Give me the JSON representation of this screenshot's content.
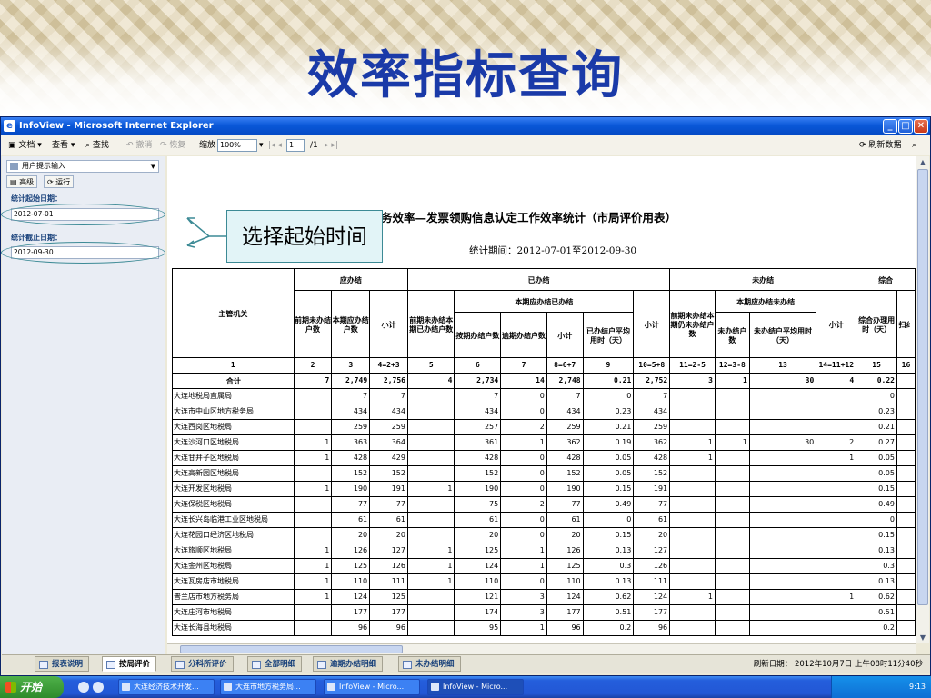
{
  "slide": {
    "title": "效率指标查询",
    "annotation": "选择起始时间"
  },
  "window": {
    "title": "InfoView - Microsoft Internet Explorer"
  },
  "toolbar": {
    "document": "文档",
    "view": "查看",
    "find": "查找",
    "undo": "撤消",
    "redo": "恢复",
    "zoom_label": "缩放",
    "zoom_value": "100%",
    "page_value": "1",
    "page_total": "/1",
    "refresh": "刷新数据"
  },
  "left_panel": {
    "prompt_dropdown": "用户提示输入",
    "advanced": "高级",
    "run": "运行",
    "start_label": "统计起始日期：",
    "start_value": "2012-07-01",
    "end_label": "统计截止日期：",
    "end_value": "2012-09-30"
  },
  "report": {
    "title": "务效率—发票领购信息认定工作效率统计（市局评价用表）",
    "period": "统计期间：2012-07-01至2012-09-30",
    "headers": {
      "org": "主管机关",
      "due": "应办结",
      "done": "已办结",
      "undone": "未办结",
      "overall": "综合",
      "done_current": "本期应办结已办结",
      "undone_current": "本期应办结未办结",
      "prior_unfinished": "前期未办结户数",
      "current_due": "本期应办结户数",
      "subtotal": "小计",
      "prior_finished": "前期未办结本期已办结户数",
      "ontime": "按期办结户数",
      "overdue": "逾期办结户数",
      "avg_time": "已办结户平均用时（天）",
      "prior_still": "前期未办结本期仍未办结户数",
      "not_done": "未办结户数",
      "undone_avg": "未办结户平均用时（天）",
      "overall_time": "综合办理用时（天）",
      "c16": "扫纟"
    },
    "index_row": [
      "1",
      "2",
      "3",
      "4=2+3",
      "5",
      "6",
      "7",
      "8=6+7",
      "9",
      "10=5+8",
      "11=2-5",
      "12=3-8",
      "13",
      "14=11+12",
      "15",
      "16"
    ],
    "total_row": [
      "合计",
      "7",
      "2,749",
      "2,756",
      "4",
      "2,734",
      "14",
      "2,748",
      "0.21",
      "2,752",
      "3",
      "1",
      "30",
      "4",
      "0.22",
      ""
    ],
    "rows": [
      [
        "大连地税局直属局",
        "",
        "7",
        "7",
        "",
        "7",
        "0",
        "7",
        "0",
        "7",
        "",
        "",
        "",
        "",
        "0",
        ""
      ],
      [
        "大连市中山区地方税务局",
        "",
        "434",
        "434",
        "",
        "434",
        "0",
        "434",
        "0.23",
        "434",
        "",
        "",
        "",
        "",
        "0.23",
        ""
      ],
      [
        "大连西岗区地税局",
        "",
        "259",
        "259",
        "",
        "257",
        "2",
        "259",
        "0.21",
        "259",
        "",
        "",
        "",
        "",
        "0.21",
        ""
      ],
      [
        "大连沙河口区地税局",
        "1",
        "363",
        "364",
        "",
        "361",
        "1",
        "362",
        "0.19",
        "362",
        "1",
        "1",
        "30",
        "2",
        "0.27",
        ""
      ],
      [
        "大连甘井子区地税局",
        "1",
        "428",
        "429",
        "",
        "428",
        "0",
        "428",
        "0.05",
        "428",
        "1",
        "",
        "",
        "1",
        "0.05",
        ""
      ],
      [
        "大连高新园区地税局",
        "",
        "152",
        "152",
        "",
        "152",
        "0",
        "152",
        "0.05",
        "152",
        "",
        "",
        "",
        "",
        "0.05",
        ""
      ],
      [
        "大连开发区地税局",
        "1",
        "190",
        "191",
        "1",
        "190",
        "0",
        "190",
        "0.15",
        "191",
        "",
        "",
        "",
        "",
        "0.15",
        ""
      ],
      [
        "大连保税区地税局",
        "",
        "77",
        "77",
        "",
        "75",
        "2",
        "77",
        "0.49",
        "77",
        "",
        "",
        "",
        "",
        "0.49",
        ""
      ],
      [
        "大连长兴岛临港工业区地税局",
        "",
        "61",
        "61",
        "",
        "61",
        "0",
        "61",
        "0",
        "61",
        "",
        "",
        "",
        "",
        "0",
        ""
      ],
      [
        "大连花园口经济区地税局",
        "",
        "20",
        "20",
        "",
        "20",
        "0",
        "20",
        "0.15",
        "20",
        "",
        "",
        "",
        "",
        "0.15",
        ""
      ],
      [
        "大连旅顺区地税局",
        "1",
        "126",
        "127",
        "1",
        "125",
        "1",
        "126",
        "0.13",
        "127",
        "",
        "",
        "",
        "",
        "0.13",
        ""
      ],
      [
        "大连金州区地税局",
        "1",
        "125",
        "126",
        "1",
        "124",
        "1",
        "125",
        "0.3",
        "126",
        "",
        "",
        "",
        "",
        "0.3",
        ""
      ],
      [
        "大连瓦房店市地税局",
        "1",
        "110",
        "111",
        "1",
        "110",
        "0",
        "110",
        "0.13",
        "111",
        "",
        "",
        "",
        "",
        "0.13",
        ""
      ],
      [
        "普兰店市地方税务局",
        "1",
        "124",
        "125",
        "",
        "121",
        "3",
        "124",
        "0.62",
        "124",
        "1",
        "",
        "",
        "1",
        "0.62",
        ""
      ],
      [
        "大连庄河市地税局",
        "",
        "177",
        "177",
        "",
        "174",
        "3",
        "177",
        "0.51",
        "177",
        "",
        "",
        "",
        "",
        "0.51",
        ""
      ],
      [
        "大连长海县地税局",
        "",
        "96",
        "96",
        "",
        "95",
        "1",
        "96",
        "0.2",
        "96",
        "",
        "",
        "",
        "",
        "0.2",
        ""
      ]
    ]
  },
  "tabs": [
    {
      "label": "报表说明",
      "active": false
    },
    {
      "label": "按局评价",
      "active": true
    },
    {
      "label": "分科所评价",
      "active": false
    },
    {
      "label": "全部明细",
      "active": false
    },
    {
      "label": "逾期办结明细",
      "active": false
    },
    {
      "label": "未办结明细",
      "active": false
    }
  ],
  "status": {
    "refresh_date": "刷新日期： 2012年10月7日 上午08时11分40秒"
  },
  "taskbar": {
    "start": "开始",
    "items": [
      "大连经济技术开发...",
      "大连市地方税务局...",
      "InfoView - Micro...",
      "InfoView - Micro..."
    ],
    "clock": "9:13"
  }
}
